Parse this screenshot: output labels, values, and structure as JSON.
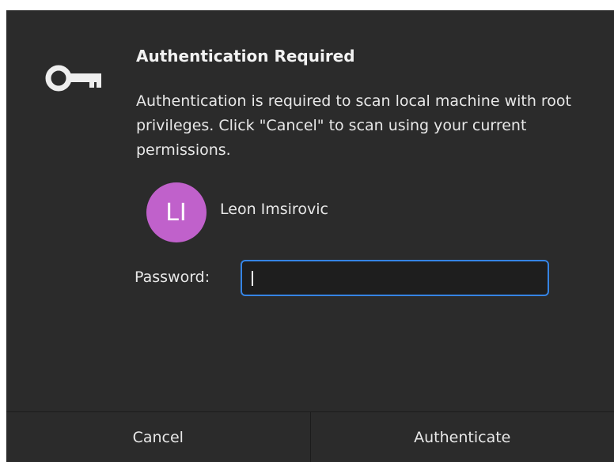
{
  "dialog": {
    "title": "Authentication Required",
    "message": "Authentication is required to scan local machine with root privileges. Click \"Cancel\" to scan using your current permissions.",
    "icon": "key-icon"
  },
  "user": {
    "initials": "LI",
    "name": "Leon Imsirovic",
    "avatar_color": "#c061cb"
  },
  "password": {
    "label": "Password:",
    "value": ""
  },
  "buttons": {
    "cancel": "Cancel",
    "authenticate": "Authenticate"
  },
  "colors": {
    "background": "#2b2b2b",
    "accent": "#3584e4"
  }
}
